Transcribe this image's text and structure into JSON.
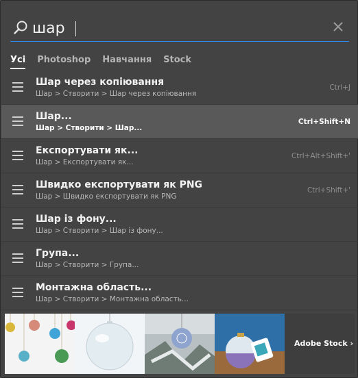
{
  "search": {
    "query": "шар"
  },
  "tabs": [
    {
      "label": "Усі",
      "active": true
    },
    {
      "label": "Photoshop",
      "active": false
    },
    {
      "label": "Навчання",
      "active": false
    },
    {
      "label": "Stock",
      "active": false
    }
  ],
  "results": [
    {
      "title": "Шар через копіювання",
      "path": "Шар > Створити > Шар через копіювання",
      "shortcut": "Ctrl+J",
      "selected": false
    },
    {
      "title": "Шар...",
      "path": "Шар > Створити > Шар...",
      "shortcut": "Ctrl+Shift+N",
      "selected": true
    },
    {
      "title": "Експортувати як...",
      "path": "Шар > Експортувати як...",
      "shortcut": "Ctrl+Alt+Shift+'",
      "selected": false
    },
    {
      "title": "Швидко експортувати як PNG",
      "path": "Шар > Швидко експортувати як PNG",
      "shortcut": "Ctrl+Shift+'",
      "selected": false
    },
    {
      "title": "Шар із фону...",
      "path": "Шар > Створити > Шар із фону...",
      "shortcut": "",
      "selected": false
    },
    {
      "title": "Група...",
      "path": "Шар > Створити > Група...",
      "shortcut": "",
      "selected": false
    },
    {
      "title": "Монтажна область...",
      "path": "Шар > Створити > Монтажна область...",
      "shortcut": "",
      "selected": false
    }
  ],
  "stock": {
    "link_label": "Adobe Stock ›",
    "thumbnails": [
      "colorful-ornaments-image",
      "glass-ornament-image",
      "blue-ornament-snow-image",
      "gift-ornament-image"
    ]
  },
  "colors": {
    "accent": "#2d8ceb",
    "panel": "#434343",
    "selected_row": "#595959"
  }
}
